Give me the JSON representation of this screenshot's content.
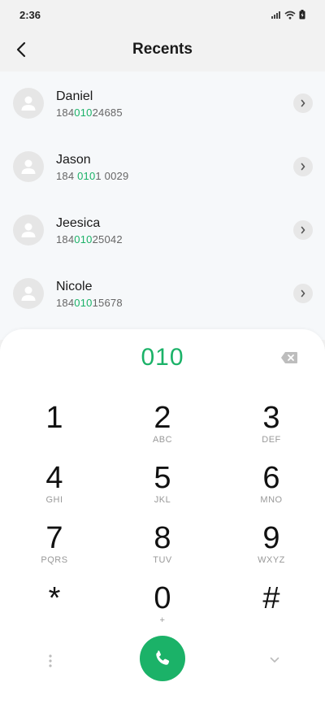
{
  "status_bar": {
    "time": "2:36"
  },
  "header": {
    "title": "Recents"
  },
  "recents": [
    {
      "name": "Daniel",
      "number_prefix": "184",
      "number_match": "010",
      "number_suffix": "24685"
    },
    {
      "name": "Jason",
      "number_prefix": "184 ",
      "number_match": "010",
      "number_suffix": "1 0029"
    },
    {
      "name": "Jeesica",
      "number_prefix": "184",
      "number_match": "010",
      "number_suffix": "25042"
    },
    {
      "name": "Nicole",
      "number_prefix": "184",
      "number_match": "010",
      "number_suffix": "15678"
    }
  ],
  "dialer": {
    "dialed": "010",
    "keys": [
      {
        "digit": "1",
        "letters": ""
      },
      {
        "digit": "2",
        "letters": "ABC"
      },
      {
        "digit": "3",
        "letters": "DEF"
      },
      {
        "digit": "4",
        "letters": "GHI"
      },
      {
        "digit": "5",
        "letters": "JKL"
      },
      {
        "digit": "6",
        "letters": "MNO"
      },
      {
        "digit": "7",
        "letters": "PQRS"
      },
      {
        "digit": "8",
        "letters": "TUV"
      },
      {
        "digit": "9",
        "letters": "WXYZ"
      },
      {
        "digit": "*",
        "letters": ""
      },
      {
        "digit": "0",
        "letters": "+"
      },
      {
        "digit": "#",
        "letters": ""
      }
    ]
  },
  "colors": {
    "accent": "#1bb268",
    "list_bg": "#f6f8fa",
    "header_bg": "#f2f2f2"
  },
  "icons": {
    "back": "chevron-left-icon",
    "chevron": "chevron-right-icon",
    "avatar": "person-icon",
    "backspace": "backspace-icon",
    "call": "phone-icon",
    "more": "more-vertical-icon",
    "collapse": "chevron-down-icon"
  }
}
